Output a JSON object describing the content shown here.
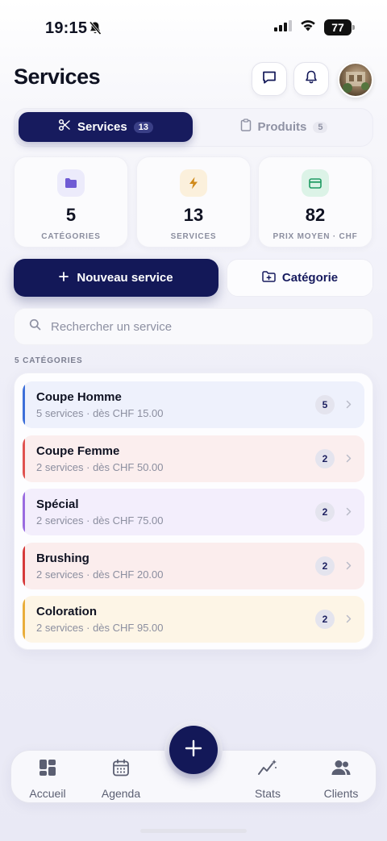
{
  "status": {
    "time": "19:15",
    "battery": "77"
  },
  "header": {
    "title": "Services"
  },
  "tabs": [
    {
      "label": "Services",
      "count": "13"
    },
    {
      "label": "Produits",
      "count": "5"
    }
  ],
  "stats": [
    {
      "value": "5",
      "label": "CATÉGORIES",
      "icon": "folder-icon",
      "color": "#6f5bd4",
      "bg": "#ecebfb"
    },
    {
      "value": "13",
      "label": "SERVICES",
      "icon": "bolt-icon",
      "color": "#d08a1a",
      "bg": "#fbf0dc"
    },
    {
      "value": "82",
      "label": "PRIX MOYEN · CHF",
      "icon": "card-icon",
      "color": "#1f9a63",
      "bg": "#dcf3e7"
    }
  ],
  "actions": {
    "new_service": "Nouveau service",
    "category": "Catégorie"
  },
  "search": {
    "placeholder": "Rechercher un service"
  },
  "section_label": "5 CATÉGORIES",
  "categories": [
    {
      "name": "Coupe Homme",
      "sub": "5 services · dès CHF 15.00",
      "count": "5",
      "accent": "#3d6fd9",
      "bg": "#eef1fc"
    },
    {
      "name": "Coupe Femme",
      "sub": "2 services · dès CHF 50.00",
      "count": "2",
      "accent": "#e0524f",
      "bg": "#fbeeee"
    },
    {
      "name": "Spécial",
      "sub": "2 services · dès CHF 75.00",
      "count": "2",
      "accent": "#9a6be0",
      "bg": "#f3eefc"
    },
    {
      "name": "Brushing",
      "sub": "2 services · dès CHF 20.00",
      "count": "2",
      "accent": "#d63a3a",
      "bg": "#fbeded"
    },
    {
      "name": "Coloration",
      "sub": "2 services · dès CHF 95.00",
      "count": "2",
      "accent": "#e9ad3a",
      "bg": "#fdf5e6"
    }
  ],
  "nav": {
    "home": "Accueil",
    "agenda": "Agenda",
    "stats": "Stats",
    "clients": "Clients"
  }
}
